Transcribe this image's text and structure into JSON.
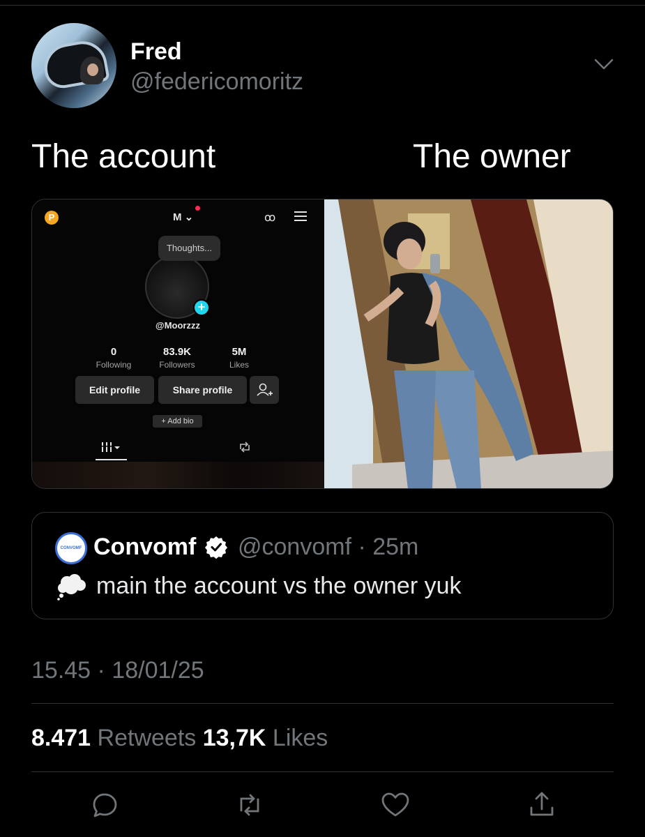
{
  "tweet": {
    "author_name": "Fred",
    "author_handle": "@federicomoritz",
    "caption_left": "The account",
    "caption_right": "The owner",
    "timestamp": "15.45 · 18/01/25",
    "retweets_count": "8.471",
    "retweets_label": "Retweets",
    "likes_count": "13,7K",
    "likes_label": "Likes"
  },
  "screenshot": {
    "badge": "P",
    "username": "M",
    "thoughts": "Thoughts...",
    "handle": "@Moorzzz",
    "stats": [
      {
        "value": "0",
        "label": "Following"
      },
      {
        "value": "83.9K",
        "label": "Followers"
      },
      {
        "value": "5M",
        "label": "Likes"
      }
    ],
    "edit_profile": "Edit profile",
    "share_profile": "Share profile",
    "add_bio": "+ Add bio"
  },
  "quote": {
    "name": "Convomf",
    "handle_time": "@convomf · 25m",
    "text": "main the account vs the owner yuk",
    "avatar_text": "CONVOMF"
  },
  "colors": {
    "background": "#000000",
    "secondary_text": "#71767b",
    "border": "#2f3336",
    "verified": "#ffffff",
    "tiktok_plus": "#20d5ec"
  },
  "icons": [
    "chevron-down-icon",
    "verified-icon",
    "thought-cloud-icon",
    "reply-icon",
    "retweet-icon",
    "like-icon",
    "share-icon"
  ]
}
